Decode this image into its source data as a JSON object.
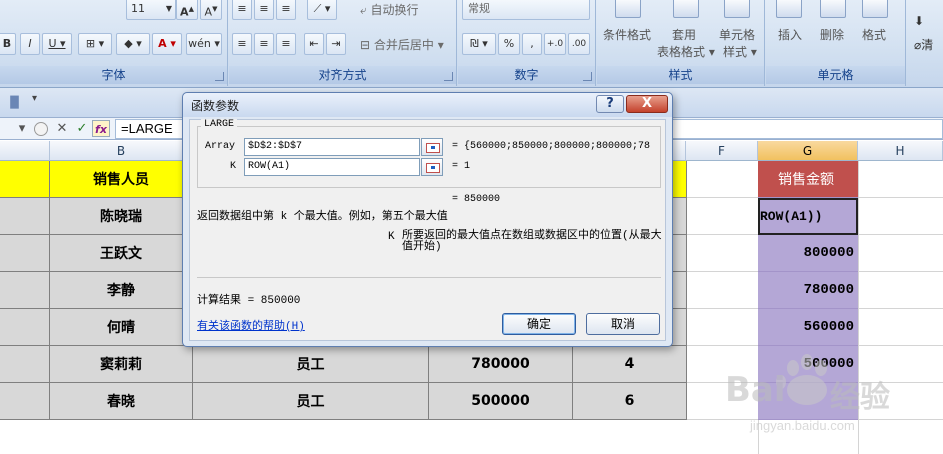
{
  "ribbon": {
    "font_size": "11",
    "wrap_text": "自动换行",
    "merge_center": "合并后居中",
    "number_format": "常规",
    "percent": "%",
    "comma": ",",
    "dec_inc": "+.0",
    "dec_dec": ".00",
    "cond_format": "条件格式",
    "table_format_1": "套用",
    "table_format_2": "表格格式",
    "cell_style_1": "单元格",
    "cell_style_2": "样式",
    "insert": "插入",
    "delete": "删除",
    "format": "格式",
    "clear": "清",
    "groups": {
      "font": "字体",
      "alignment": "对齐方式",
      "number": "数字",
      "styles": "样式",
      "cells": "单元格"
    }
  },
  "formula_bar": {
    "formula": "=LARGE",
    "fx": "fx"
  },
  "columns": {
    "b": "B",
    "f": "F",
    "g": "G",
    "h": "H"
  },
  "sheet": {
    "header_label": "销售人员",
    "names": [
      "陈晓瑞",
      "王跃文",
      "李静",
      "何晴",
      "窦莉莉",
      "春晓"
    ],
    "rows5": {
      "role": "员工",
      "amount": "780000",
      "rank": "4"
    },
    "rows6": {
      "role": "员工",
      "amount": "500000",
      "rank": "6"
    },
    "g_header": "销售金额",
    "g_editing": "ROW(A1))",
    "g_values": [
      "800000",
      "780000",
      "560000",
      "500000"
    ]
  },
  "dialog": {
    "title": "函数参数",
    "help_btn": "?",
    "close_btn": "X",
    "function_name": "LARGE",
    "args": [
      {
        "label": "Array",
        "value": "$D$2:$D$7",
        "result": "= {560000;850000;800000;800000;78"
      },
      {
        "label": "K",
        "value": "ROW(A1)",
        "result": "= 1"
      }
    ],
    "total_result": "= 850000",
    "description": "返回数据组中第 k 个最大值。例如，第五个最大值",
    "arg_desc_name": "K",
    "arg_desc_text": "所要返回的最大值点在数组或数据区中的位置(从最大值开始)",
    "calc_result": "计算结果 = 850000",
    "help_link": "有关该函数的帮助(H)",
    "ok": "确定",
    "cancel": "取消"
  },
  "watermark": {
    "logo": "Bai",
    "logo2": "经验",
    "url": "jingyan.baidu.com"
  }
}
